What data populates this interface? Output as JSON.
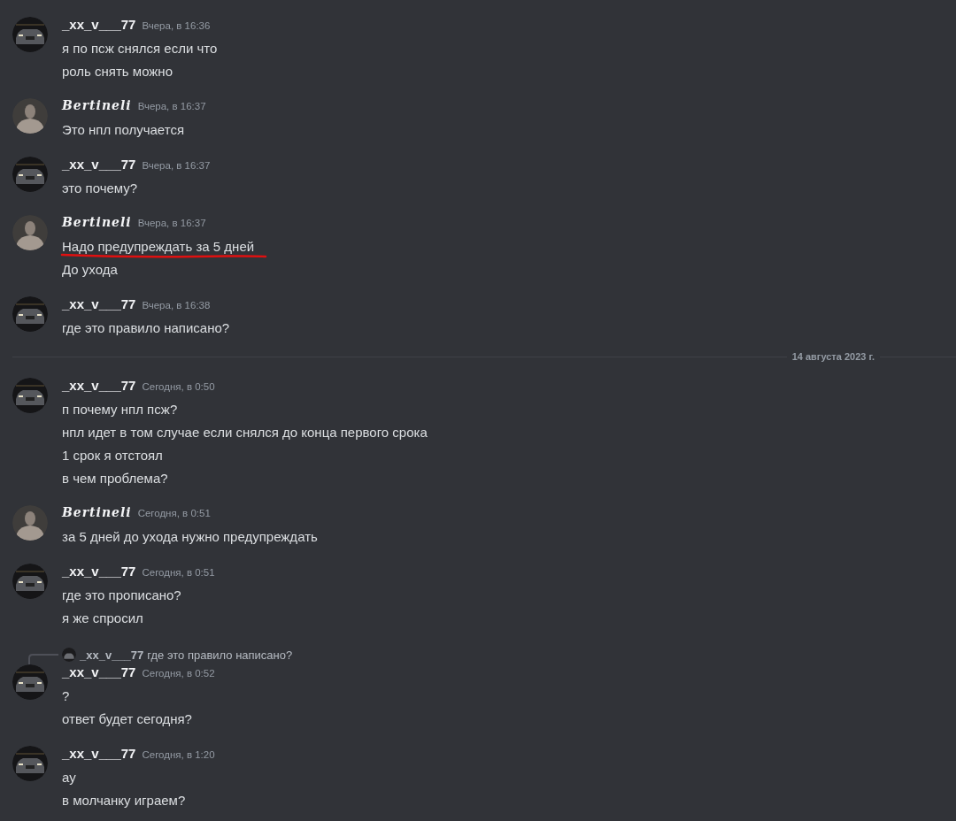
{
  "messages": [
    {
      "kind": "message",
      "avatar": {
        "kind": "car"
      },
      "author": "_xx_v___77",
      "time": "Вчера, в 16:36",
      "lines": [
        {
          "text": "я по псж снялся если что",
          "underlined": false
        },
        {
          "text": "роль снять можно",
          "underlined": false
        }
      ]
    },
    {
      "kind": "message",
      "avatar": {
        "kind": "figure"
      },
      "author": "Bertineli",
      "time": "Вчера, в 16:37",
      "lines": [
        {
          "text": "Это нпл получается",
          "underlined": false
        }
      ]
    },
    {
      "kind": "message",
      "avatar": {
        "kind": "car"
      },
      "author": "_xx_v___77",
      "time": "Вчера, в 16:37",
      "lines": [
        {
          "text": "это почему?",
          "underlined": false
        }
      ]
    },
    {
      "kind": "message",
      "avatar": {
        "kind": "figure"
      },
      "author": "Bertineli",
      "time": "Вчера, в 16:37",
      "lines": [
        {
          "text": "Надо предупреждать за 5 дней",
          "underlined": true
        },
        {
          "text": "До ухода",
          "underlined": false
        }
      ]
    },
    {
      "kind": "message",
      "avatar": {
        "kind": "car"
      },
      "author": "_xx_v___77",
      "time": "Вчера, в 16:38",
      "lines": [
        {
          "text": "где это правило написано?",
          "underlined": false
        }
      ]
    },
    {
      "kind": "divider",
      "label": "14 августа 2023 г."
    },
    {
      "kind": "message",
      "avatar": {
        "kind": "car"
      },
      "author": "_xx_v___77",
      "time": "Сегодня, в 0:50",
      "lines": [
        {
          "text": "п почему нпл псж?",
          "underlined": false
        },
        {
          "text": "нпл идет в том случае если снялся до конца первого срока",
          "underlined": false
        },
        {
          "text": "1 срок я отстоял",
          "underlined": false
        },
        {
          "text": "в чем проблема?",
          "underlined": false
        }
      ]
    },
    {
      "kind": "message",
      "avatar": {
        "kind": "figure"
      },
      "author": "Bertineli",
      "time": "Сегодня, в 0:51",
      "lines": [
        {
          "text": "за 5 дней до ухода нужно предупреждать",
          "underlined": false
        }
      ]
    },
    {
      "kind": "message",
      "avatar": {
        "kind": "car"
      },
      "author": "_xx_v___77",
      "time": "Сегодня, в 0:51",
      "lines": [
        {
          "text": "где это прописано?",
          "underlined": false
        },
        {
          "text": "я же спросил",
          "underlined": false
        }
      ]
    },
    {
      "kind": "message",
      "avatar": {
        "kind": "car"
      },
      "author": "_xx_v___77",
      "time": "Сегодня, в 0:52",
      "reply": {
        "avatar": {
          "kind": "car"
        },
        "author": "_xx_v___77",
        "text": "где это правило написано?"
      },
      "lines": [
        {
          "text": "?",
          "underlined": false
        },
        {
          "text": "ответ будет сегодня?",
          "underlined": false
        }
      ]
    },
    {
      "kind": "message",
      "avatar": {
        "kind": "car"
      },
      "author": "_xx_v___77",
      "time": "Сегодня, в 1:20",
      "lines": [
        {
          "text": "ау",
          "underlined": false
        },
        {
          "text": "в молчанку играем?",
          "underlined": false
        }
      ]
    }
  ]
}
